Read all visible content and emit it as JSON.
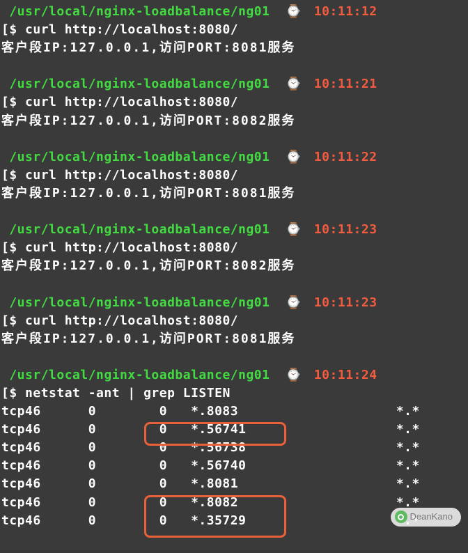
{
  "prompt_prefix": "[$ ",
  "blocks": [
    {
      "path": " /usr/local/nginx-loadbalance/ng01",
      "time": "10:11:12",
      "cmd": "curl http://localhost:8080/",
      "out": "客户段IP:127.0.0.1,访问PORT:8081服务"
    },
    {
      "path": " /usr/local/nginx-loadbalance/ng01",
      "time": "10:11:21",
      "cmd": "curl http://localhost:8080/",
      "out": "客户段IP:127.0.0.1,访问PORT:8082服务"
    },
    {
      "path": " /usr/local/nginx-loadbalance/ng01",
      "time": "10:11:22",
      "cmd": "curl http://localhost:8080/",
      "out": "客户段IP:127.0.0.1,访问PORT:8081服务"
    },
    {
      "path": " /usr/local/nginx-loadbalance/ng01",
      "time": "10:11:23",
      "cmd": "curl http://localhost:8080/",
      "out": "客户段IP:127.0.0.1,访问PORT:8082服务"
    },
    {
      "path": " /usr/local/nginx-loadbalance/ng01",
      "time": "10:11:23",
      "cmd": "curl http://localhost:8080/",
      "out": "客户段IP:127.0.0.1,访问PORT:8081服务"
    }
  ],
  "tail": {
    "path": " /usr/local/nginx-loadbalance/ng01",
    "time": "10:11:24",
    "cmd": "netstat -ant | grep LISTEN",
    "rows": [
      {
        "proto": "tcp46",
        "r": "0",
        "s": "0",
        "local": "*.8083",
        "tail": "*.*"
      },
      {
        "proto": "tcp46",
        "r": "0",
        "s": "0",
        "local": "*.56741",
        "tail": "*.*"
      },
      {
        "proto": "tcp46",
        "r": "0",
        "s": "0",
        "local": "*.56738",
        "tail": "*.*"
      },
      {
        "proto": "tcp46",
        "r": "0",
        "s": "0",
        "local": "*.56740",
        "tail": "*.*"
      },
      {
        "proto": "tcp46",
        "r": "0",
        "s": "0",
        "local": "*.8081",
        "tail": "*.*"
      },
      {
        "proto": "tcp46",
        "r": "0",
        "s": "0",
        "local": "*.8082",
        "tail": "*.*"
      },
      {
        "proto": "tcp46",
        "r": "0",
        "s": "0",
        "local": "*.35729",
        "tail": "*.*"
      }
    ]
  },
  "clock_glyph": "⌚",
  "watermark": "DeanKano"
}
